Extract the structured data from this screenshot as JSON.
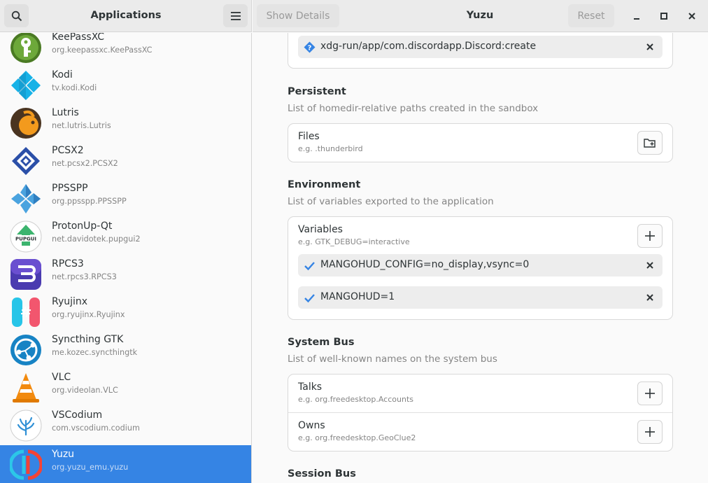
{
  "sidebar_header": {
    "title": "Applications"
  },
  "main_header": {
    "show_details": "Show Details",
    "title": "Yuzu",
    "reset": "Reset"
  },
  "apps": [
    {
      "name": "KeePassXC",
      "id": "org.keepassxc.KeePassXC",
      "icon": "keepassxc-icon"
    },
    {
      "name": "Kodi",
      "id": "tv.kodi.Kodi",
      "icon": "kodi-icon"
    },
    {
      "name": "Lutris",
      "id": "net.lutris.Lutris",
      "icon": "lutris-icon"
    },
    {
      "name": "PCSX2",
      "id": "net.pcsx2.PCSX2",
      "icon": "pcsx2-icon"
    },
    {
      "name": "PPSSPP",
      "id": "org.ppsspp.PPSSPP",
      "icon": "ppsspp-icon"
    },
    {
      "name": "ProtonUp-Qt",
      "id": "net.davidotek.pupgui2",
      "icon": "protonup-qt-icon",
      "icon_text": "PUPGUI"
    },
    {
      "name": "RPCS3",
      "id": "net.rpcs3.RPCS3",
      "icon": "rpcs3-icon"
    },
    {
      "name": "Ryujinx",
      "id": "org.ryujinx.Ryujinx",
      "icon": "ryujinx-icon"
    },
    {
      "name": "Syncthing GTK",
      "id": "me.kozec.syncthingtk",
      "icon": "syncthing-icon"
    },
    {
      "name": "VLC",
      "id": "org.videolan.VLC",
      "icon": "vlc-icon"
    },
    {
      "name": "VSCodium",
      "id": "com.vscodium.codium",
      "icon": "vscodium-icon"
    },
    {
      "name": "Yuzu",
      "id": "org.yuzu_emu.yuzu",
      "icon": "yuzu-icon",
      "selected": true
    }
  ],
  "main": {
    "top_entry": "xdg-run/app/com.discordapp.Discord:create",
    "persistent": {
      "title": "Persistent",
      "description": "List of homedir-relative paths created in the sandbox",
      "files_label": "Files",
      "files_placeholder": "e.g. .thunderbird"
    },
    "environment": {
      "title": "Environment",
      "description": "List of variables exported to the application",
      "variables_label": "Variables",
      "variables_placeholder": "e.g. GTK_DEBUG=interactive",
      "entries": [
        "MANGOHUD_CONFIG=no_display,vsync=0",
        "MANGOHUD=1"
      ]
    },
    "system_bus": {
      "title": "System Bus",
      "description": "List of well-known names on the system bus",
      "talks_label": "Talks",
      "talks_placeholder": "e.g. org.freedesktop.Accounts",
      "owns_label": "Owns",
      "owns_placeholder": "e.g. org.freedesktop.GeoClue2"
    },
    "session_bus": {
      "title": "Session Bus"
    }
  },
  "colors": {
    "selection": "#3584e4",
    "check": "#3584e4",
    "header_bg": "#ebebeb"
  }
}
